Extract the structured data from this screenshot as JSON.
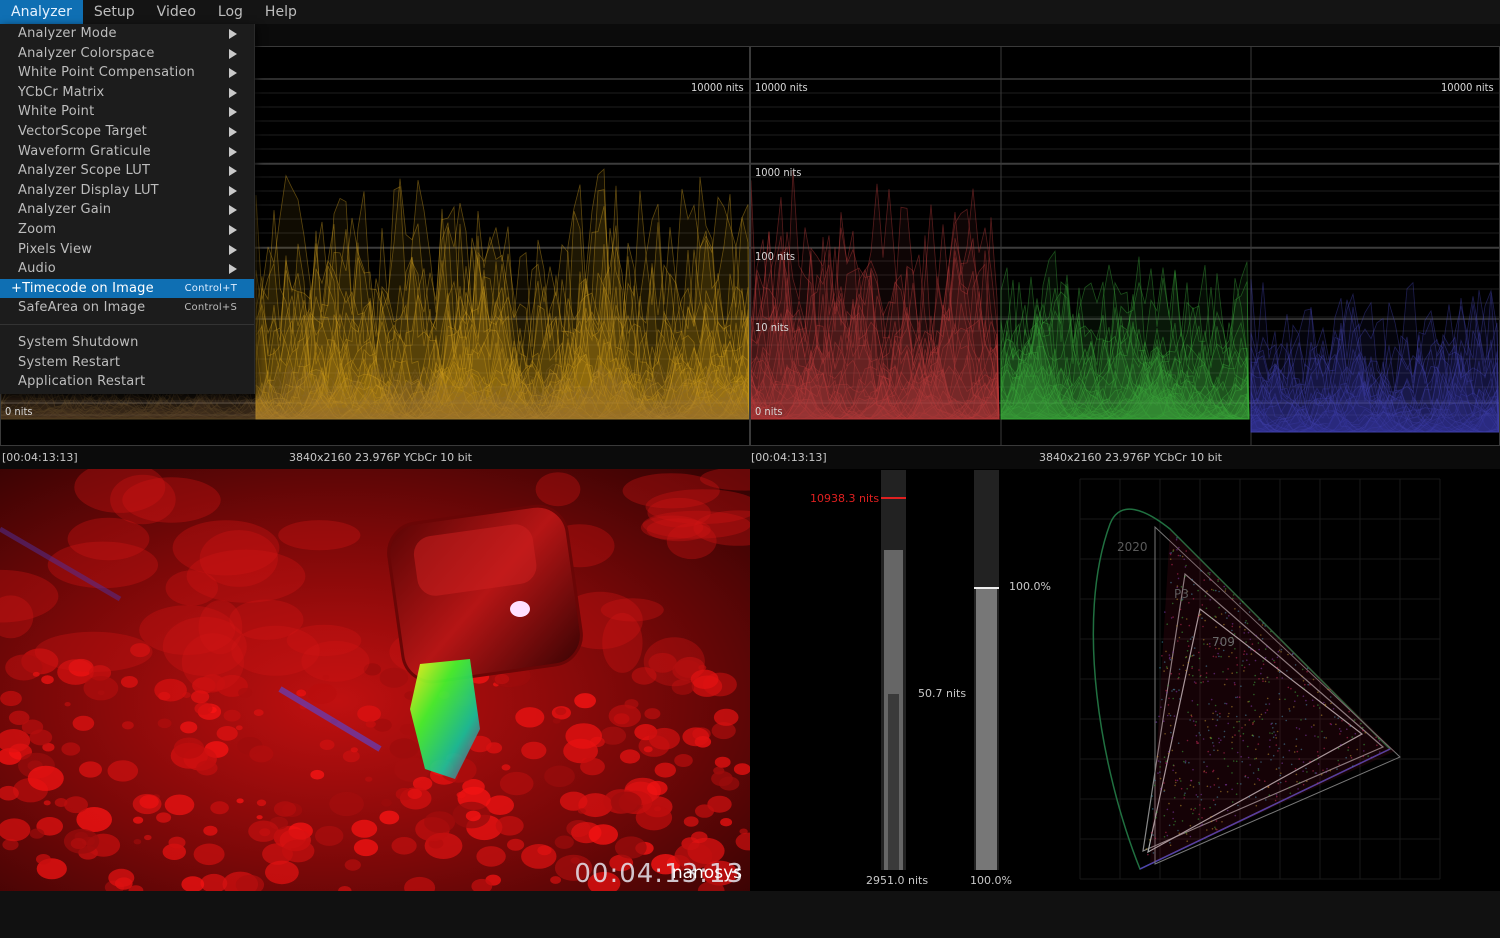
{
  "menubar": {
    "items": [
      {
        "label": "Analyzer",
        "active": true
      },
      {
        "label": "Setup",
        "active": false
      },
      {
        "label": "Video",
        "active": false
      },
      {
        "label": "Log",
        "active": false
      },
      {
        "label": "Help",
        "active": false
      }
    ]
  },
  "dropdown": {
    "submenu_items": [
      "Analyzer Mode",
      "Analyzer Colorspace",
      "White Point Compensation",
      "YCbCr Matrix",
      "White Point",
      "VectorScope Target",
      "Waveform Graticule",
      "Analyzer Scope LUT",
      "Analyzer Display LUT",
      "Analyzer Gain",
      "Zoom",
      "Pixels View",
      "Audio"
    ],
    "toggle_items": [
      {
        "label": "+Timecode on Image",
        "shortcut": "Control+T",
        "highlighted": true
      },
      {
        "label": "SafeArea on Image",
        "shortcut": "Control+S",
        "highlighted": false
      }
    ],
    "system_items": [
      "System Shutdown",
      "System Restart",
      "Application Restart"
    ]
  },
  "waveform_main": {
    "top_label": "10000 nits",
    "bottom_label": "0 nits",
    "color": "#c89a1e"
  },
  "waveform_rgb": {
    "labels": {
      "n10000_left": "10000 nits",
      "n10000_right": "10000 nits",
      "n1000": "1000 nits",
      "n100": "100 nits",
      "n10": "10 nits",
      "n0": "0 nits"
    },
    "colors": {
      "red": "#b83a3a",
      "green": "#3aa83a",
      "blue": "#4646b8"
    }
  },
  "info_left": {
    "timecode": "[00:04:13:13]",
    "format": "3840x2160 23.976P YCbCr 10 bit"
  },
  "info_right": {
    "timecode": "[00:04:13:13]",
    "format": "3840x2160 23.976P YCbCr 10 bit"
  },
  "image_overlay": {
    "timecode": "00:04:13:13",
    "logo": "nanosys"
  },
  "meters": {
    "nits": {
      "peak_label": "10938.3 nits",
      "avg_label": "50.7 nits",
      "bottom_label": "2951.0 nits",
      "peak_fraction": 0.93,
      "max_fraction": 0.8,
      "avg_fraction": 0.44
    },
    "percent": {
      "top_label": "100.0%",
      "bottom_label": "100.0%",
      "fraction": 0.705
    }
  },
  "gamut": {
    "labels": {
      "rec2020": "2020",
      "p3": "P3",
      "rec709": "709"
    }
  }
}
